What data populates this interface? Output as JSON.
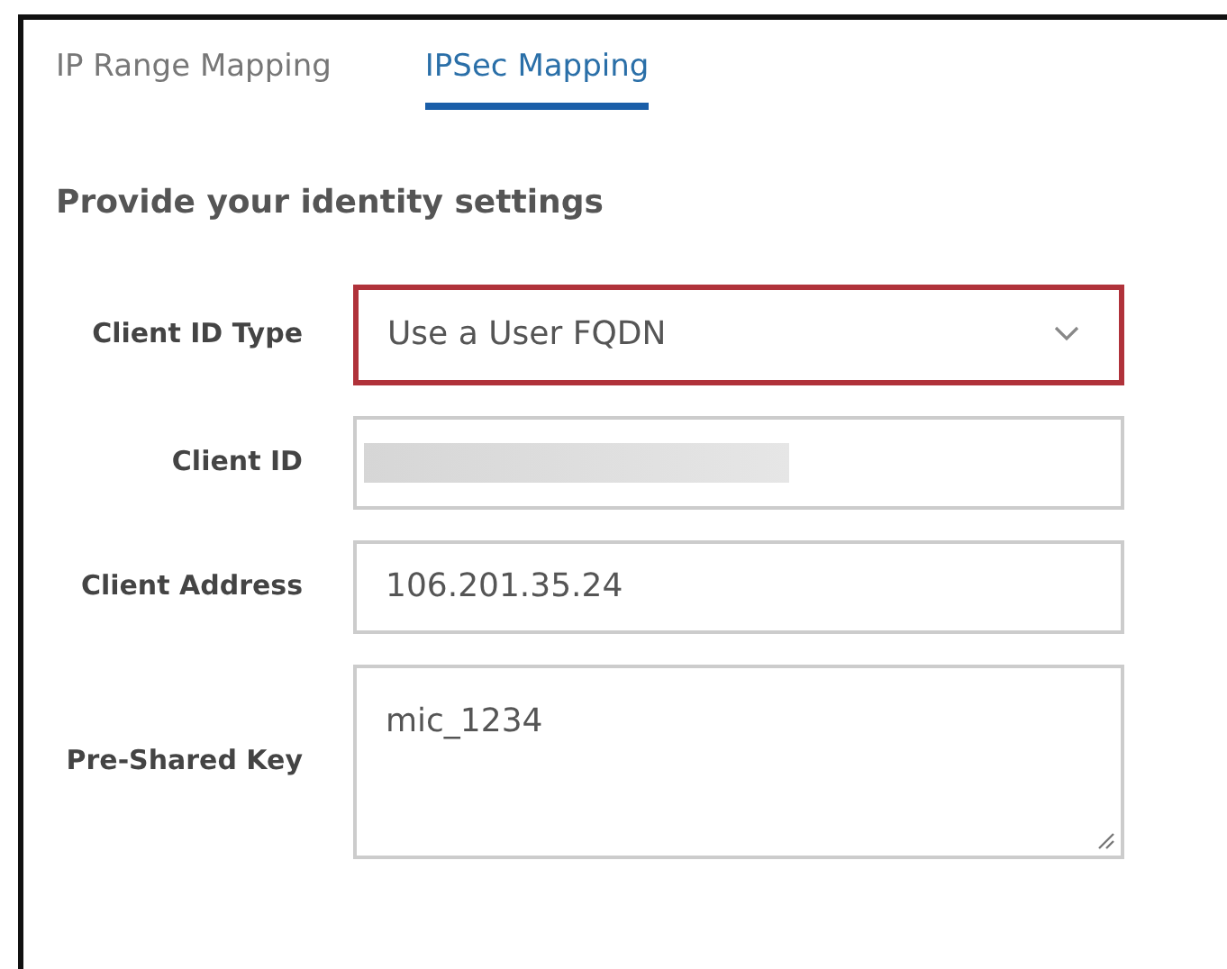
{
  "tabs": [
    {
      "label": "IP Range Mapping",
      "selected": false
    },
    {
      "label": "IPSec Mapping",
      "selected": true
    }
  ],
  "heading": "Provide your identity settings",
  "fields": [
    {
      "label": "Client ID Type",
      "kind": "select",
      "value": "Use a User FQDN",
      "highlighted": true
    },
    {
      "label": "Client ID",
      "kind": "text",
      "redacted": true
    },
    {
      "label": "Client Address",
      "kind": "text",
      "value": "106.201.35.24"
    },
    {
      "label": "Pre-Shared Key",
      "kind": "textarea",
      "value": "mic_1234"
    }
  ]
}
